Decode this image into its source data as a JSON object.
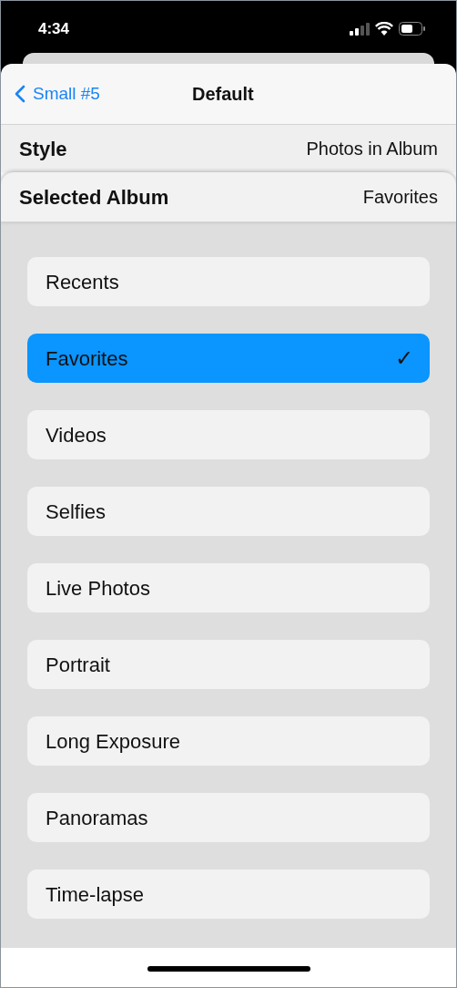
{
  "status_bar": {
    "time": "4:34"
  },
  "nav": {
    "back": "Small #5",
    "title": "Default"
  },
  "style_row": {
    "label": "Style",
    "value": "Photos in Album"
  },
  "album_row": {
    "label": "Selected Album",
    "value": "Favorites"
  },
  "albums": [
    {
      "label": "Recents",
      "selected": false
    },
    {
      "label": "Favorites",
      "selected": true,
      "check": "✓"
    },
    {
      "label": "Videos",
      "selected": false
    },
    {
      "label": "Selfies",
      "selected": false
    },
    {
      "label": "Live Photos",
      "selected": false
    },
    {
      "label": "Portrait",
      "selected": false
    },
    {
      "label": "Long Exposure",
      "selected": false
    },
    {
      "label": "Panoramas",
      "selected": false
    },
    {
      "label": "Time-lapse",
      "selected": false
    }
  ]
}
